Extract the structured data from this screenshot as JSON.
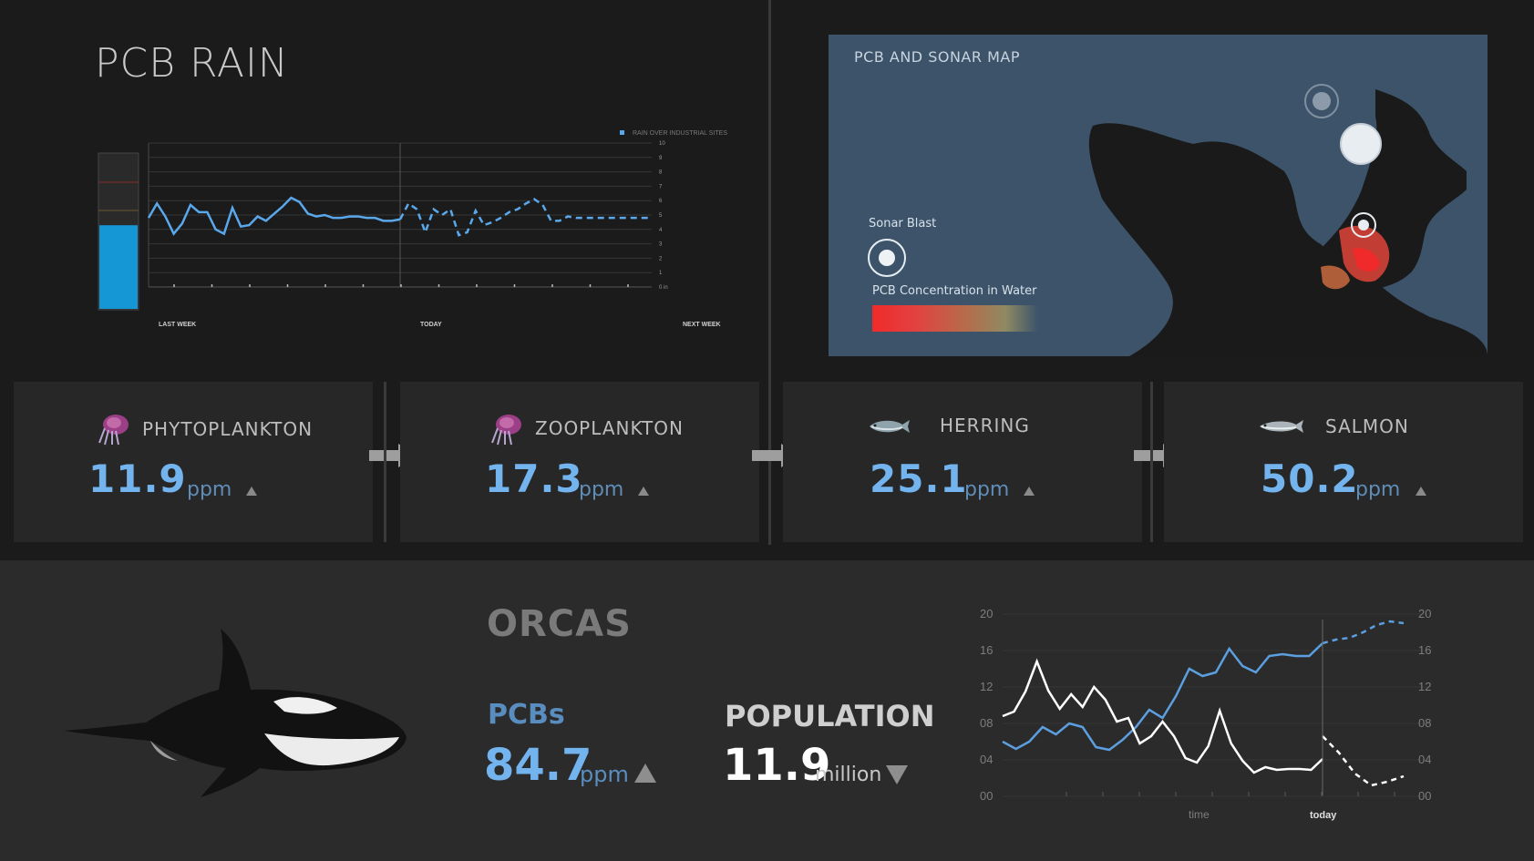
{
  "colors": {
    "background": "#1b1b1b",
    "panel": "#272727",
    "accent_blue": "#73b3ee",
    "map_water": "#3c536a",
    "pcb_red": "#f02a2a"
  },
  "pcb_rain": {
    "title": "PCB RAIN",
    "legend": "RAIN OVER INDUSTRIAL SITES",
    "x_labels": [
      "LAST WEEK",
      "TODAY",
      "NEXT WEEK"
    ],
    "gauge_fill_fraction": 0.54
  },
  "map": {
    "title": "PCB AND SONAR MAP",
    "sonar_label": "Sonar Blast",
    "pcb_label": "PCB Concentration in Water",
    "icons": [
      "sonar-blast-icon",
      "pcb-hotspot"
    ]
  },
  "species": [
    {
      "name": "PHYTOPLANKTON",
      "value": "11.9",
      "unit": "ppm",
      "icon": "plankton-icon"
    },
    {
      "name": "ZOOPLANKTON",
      "value": "17.3",
      "unit": "ppm",
      "icon": "plankton-icon"
    },
    {
      "name": "HERRING",
      "value": "25.1",
      "unit": "ppm",
      "icon": "herring-icon"
    },
    {
      "name": "SALMON",
      "value": "50.2",
      "unit": "ppm",
      "icon": "salmon-icon"
    }
  ],
  "orcas": {
    "title": "ORCAS",
    "pcbs_label": "PCBs",
    "pcbs_value": "84.7",
    "pcbs_unit": "ppm",
    "population_label": "POPULATION",
    "population_value": "11.9",
    "population_unit": "million"
  },
  "chart_data": [
    {
      "type": "line",
      "title": "",
      "x_labels": [
        "LAST WEEK",
        "TODAY",
        "NEXT WEEK"
      ],
      "y_ticks": [
        "10",
        "9",
        "8",
        "7",
        "6",
        "5",
        "4",
        "3",
        "2",
        "1",
        "0 in"
      ],
      "ylim": [
        0,
        10
      ],
      "legend": "RAIN OVER INDUSTRIAL SITES",
      "legend_placement": "top-right",
      "grid": true,
      "series": [
        {
          "name": "RAIN OVER INDUSTRIAL SITES",
          "color": "#5aa8ec",
          "x": [
            0,
            1,
            2,
            3,
            4,
            5,
            6,
            7,
            8,
            9,
            10,
            11,
            12,
            13,
            14,
            15,
            16,
            17,
            18,
            19,
            20,
            21,
            22,
            23,
            24,
            25,
            26,
            27,
            28,
            29,
            30,
            31,
            32,
            33,
            34,
            35,
            36,
            37,
            38,
            39,
            40,
            41,
            42,
            43,
            44,
            45,
            46,
            47,
            48,
            49,
            50,
            51,
            52,
            53,
            54,
            55,
            56,
            57,
            58,
            59,
            60
          ],
          "values": [
            4.8,
            5.8,
            4.9,
            3.7,
            4.4,
            5.7,
            5.2,
            5.2,
            4.0,
            3.7,
            5.5,
            4.2,
            4.3,
            4.9,
            4.6,
            5.1,
            5.6,
            6.2,
            5.9,
            5.1,
            4.9,
            5.0,
            4.8,
            4.8,
            4.9,
            4.9,
            4.8,
            4.8,
            4.6,
            4.6,
            4.7,
            5.8,
            5.4,
            3.8,
            5.4,
            5.0,
            5.4,
            3.6,
            3.8,
            5.3,
            4.3,
            4.5,
            4.8,
            5.2,
            5.4,
            5.8,
            6.1,
            5.7,
            4.6,
            4.6,
            4.9,
            4.8,
            4.8,
            4.8,
            4.8,
            4.8,
            4.8,
            4.8,
            4.8,
            4.8,
            4.8
          ],
          "today_index": 30
        }
      ]
    },
    {
      "type": "line",
      "x_labels": [
        "time",
        "today"
      ],
      "y_ticks": [
        "20",
        "16",
        "12",
        "08",
        "04",
        "00"
      ],
      "ylim": [
        0,
        20
      ],
      "grid": true,
      "series": [
        {
          "color": "#5c9fe0",
          "values": [
            6,
            5.2,
            6,
            7.6,
            6.8,
            8,
            7.6,
            5.4,
            5.1,
            6.2,
            7.6,
            9.5,
            8.6,
            11,
            14,
            13.2,
            13.6,
            16.2,
            14.3,
            13.6,
            15.4,
            15.6,
            15.4,
            15.4,
            16.8
          ],
          "forecast": [
            16.8,
            17.2,
            17.4,
            18,
            18.8,
            19.2,
            19
          ]
        },
        {
          "color": "#ffffff",
          "values": [
            8.8,
            9.3,
            11.5,
            14.8,
            11.6,
            9.6,
            11.2,
            9.8,
            12,
            10.6,
            8.2,
            8.6,
            5.8,
            6.6,
            8.2,
            6.6,
            4.2,
            3.7,
            5.5,
            9.4,
            5.8,
            3.9,
            2.6,
            3.2,
            2.9,
            3.0,
            3.0,
            2.9,
            4.1
          ],
          "forecast": [
            6.6,
            4.8,
            2.5,
            1.2,
            1.6,
            2.2
          ]
        }
      ]
    }
  ]
}
